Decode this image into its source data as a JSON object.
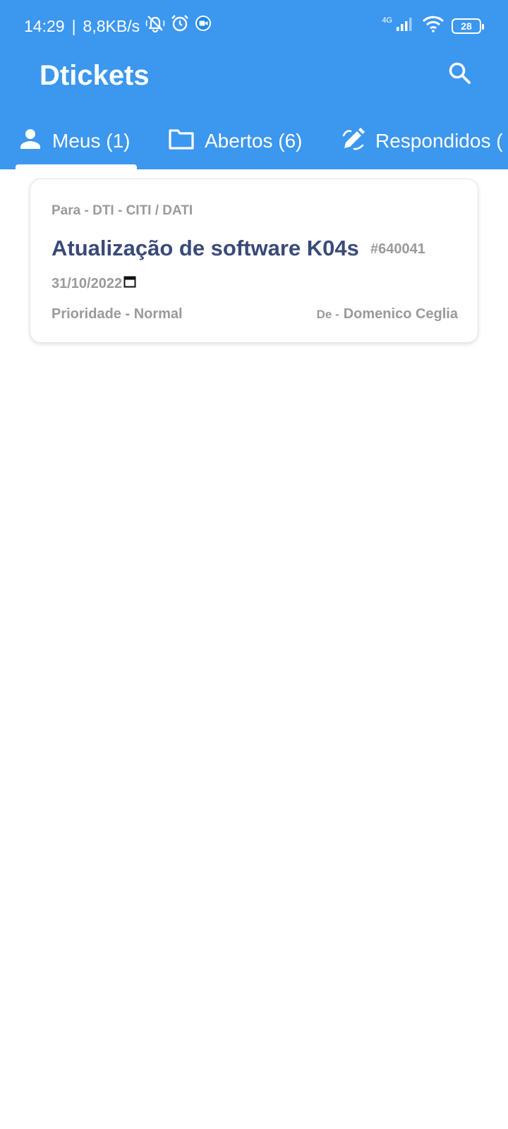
{
  "status_bar": {
    "time": "14:29",
    "speed": "8,8KB/s",
    "network": "4G",
    "battery": "28",
    "icons": [
      "mute-icon",
      "alarm-icon",
      "video-call-icon",
      "signal-icon",
      "wifi-icon",
      "battery-icon"
    ]
  },
  "app": {
    "title": "Dtickets",
    "accent_color": "#3c97ef"
  },
  "tabs": [
    {
      "label": "Meus (1)",
      "icon": "person-icon",
      "selected": true
    },
    {
      "label": "Abertos (6)",
      "icon": "folder-icon",
      "selected": false
    },
    {
      "label": "Respondidos (",
      "icon": "edit-icon",
      "selected": false
    }
  ],
  "tickets": [
    {
      "to": "Para - DTI - CITI / DATI",
      "title": "Atualização de software K04s",
      "id": "#640041",
      "date": "31/10/2022",
      "priority": "Prioridade - Normal",
      "from_prefix": "De -",
      "from_name": "Domenico Ceglia"
    }
  ]
}
